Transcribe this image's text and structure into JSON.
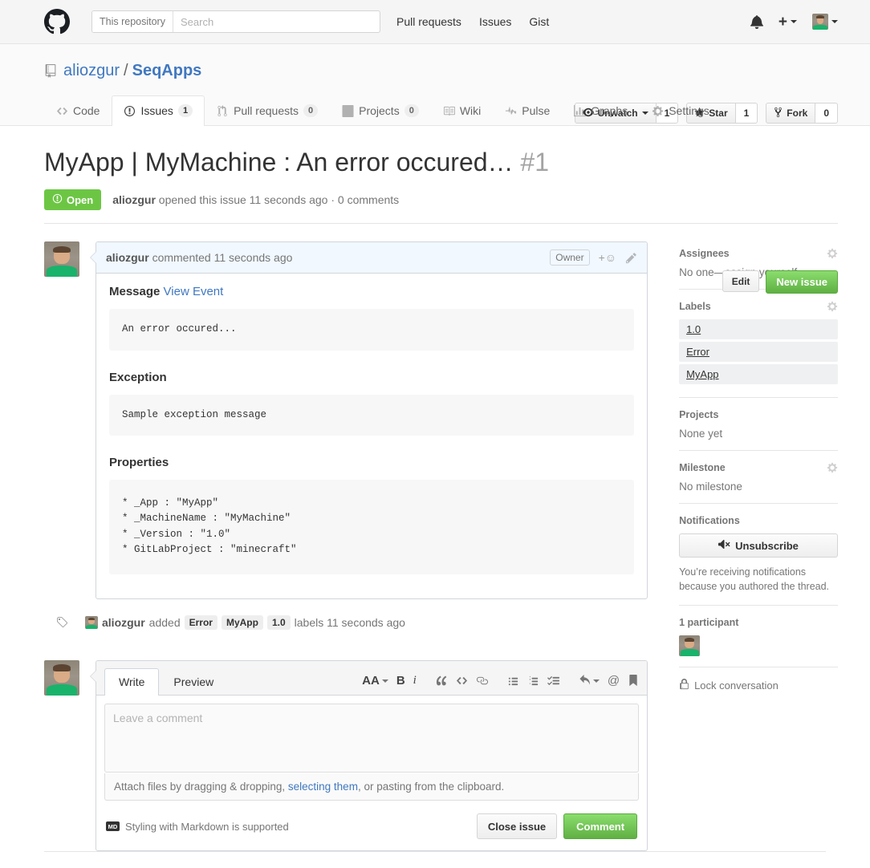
{
  "header": {
    "logo_icon": "github-mark-icon",
    "search": {
      "context": "This repository",
      "placeholder": "Search",
      "value": ""
    },
    "nav": [
      {
        "label": "Pull requests"
      },
      {
        "label": "Issues"
      },
      {
        "label": "Gist"
      }
    ],
    "notifications_icon": "bell-icon",
    "create_new_icon": "plus-icon",
    "avatar_icon": "user-avatar"
  },
  "repo": {
    "book_icon": "repo-book-icon",
    "owner": "aliozgur",
    "separator": "/",
    "name": "SeqApps",
    "actions": [
      {
        "icon": "eye-icon",
        "label": "Unwatch",
        "count": "1",
        "has_caret": true
      },
      {
        "icon": "star-icon",
        "label": "Star",
        "count": "1",
        "has_caret": false
      },
      {
        "icon": "fork-icon",
        "label": "Fork",
        "count": "0",
        "has_caret": false
      }
    ],
    "tabs": [
      {
        "icon": "code-icon",
        "label": "Code",
        "count": null,
        "selected": false
      },
      {
        "icon": "issue-opened-icon",
        "label": "Issues",
        "count": "1",
        "selected": true
      },
      {
        "icon": "git-pull-request-icon",
        "label": "Pull requests",
        "count": "0",
        "selected": false
      },
      {
        "icon": "project-icon",
        "label": "Projects",
        "count": "0",
        "selected": false
      },
      {
        "icon": "book-icon",
        "label": "Wiki",
        "count": null,
        "selected": false
      },
      {
        "icon": "pulse-icon",
        "label": "Pulse",
        "count": null,
        "selected": false
      },
      {
        "icon": "graph-icon",
        "label": "Graphs",
        "count": null,
        "selected": false
      },
      {
        "icon": "gear-icon",
        "label": "Settings",
        "count": null,
        "selected": false
      }
    ]
  },
  "issue": {
    "title": "MyApp | MyMachine : An error occured…",
    "number": "#1",
    "edit_label": "Edit",
    "new_issue_label": "New issue",
    "state_icon": "issue-opened-icon",
    "state_label": "Open",
    "meta_author": "aliozgur",
    "meta_text": "opened this issue 11 seconds ago · 0 comments"
  },
  "comment": {
    "author": "aliozgur",
    "action_text": "commented 11 seconds ago",
    "owner_badge": "Owner",
    "reaction_icon": "add-reaction-icon",
    "edit_icon": "pencil-icon",
    "sections": [
      {
        "heading": "Message",
        "link": "View Event",
        "code": "An error occured..."
      },
      {
        "heading": "Exception",
        "link": null,
        "code": "Sample exception message"
      },
      {
        "heading": "Properties",
        "link": null,
        "code": "* _App : \"MyApp\"\n* _MachineName : \"MyMachine\"\n* _Version : \"1.0\"\n* GitLabProject : \"minecraft\""
      }
    ]
  },
  "timeline": {
    "icon": "tag-icon",
    "author": "aliozgur",
    "verb": "added",
    "labels": [
      "Error",
      "MyApp",
      "1.0"
    ],
    "suffix": "labels 11 seconds ago"
  },
  "comment_form": {
    "tabs": [
      {
        "label": "Write",
        "active": true
      },
      {
        "label": "Preview",
        "active": false
      }
    ],
    "toolbar": [
      {
        "icon": "text-size-icon",
        "label": "AA"
      },
      {
        "icon": "bold-icon",
        "label": "B"
      },
      {
        "icon": "italic-icon",
        "label": "i"
      },
      {
        "icon": "quote-icon",
        "label": "“"
      },
      {
        "icon": "code-icon",
        "label": "<>"
      },
      {
        "icon": "link-icon",
        "label": "link"
      },
      {
        "icon": "unordered-list-icon",
        "label": "list"
      },
      {
        "icon": "ordered-list-icon",
        "label": "numbered list"
      },
      {
        "icon": "task-list-icon",
        "label": "task list"
      },
      {
        "icon": "reply-icon",
        "label": "reply"
      },
      {
        "icon": "mention-icon",
        "label": "@"
      },
      {
        "icon": "saved-replies-icon",
        "label": "bookmark"
      }
    ],
    "textarea_placeholder": "Leave a comment",
    "textarea_value": "",
    "attach_prefix": "Attach files by dragging & dropping, ",
    "attach_link": "selecting them",
    "attach_suffix": ", or pasting from the clipboard.",
    "markdown_badge": "MD",
    "markdown_note": "Styling with Markdown is supported",
    "close_issue_label": "Close issue",
    "comment_label": "Comment"
  },
  "sidebar": {
    "assignees": {
      "title": "Assignees",
      "gear_icon": "gear-icon",
      "empty": "No one—assign yourself"
    },
    "labels": {
      "title": "Labels",
      "gear_icon": "gear-icon",
      "items": [
        "1.0",
        "Error",
        "MyApp"
      ]
    },
    "projects": {
      "title": "Projects",
      "empty": "None yet"
    },
    "milestone": {
      "title": "Milestone",
      "gear_icon": "gear-icon",
      "empty": "No milestone"
    },
    "notifications": {
      "title": "Notifications",
      "button_icon": "mute-icon",
      "button_label": "Unsubscribe",
      "note": "You’re receiving notifications because you authored the thread."
    },
    "participants": {
      "title": "1 participant",
      "avatar_icon": "user-avatar"
    },
    "lock": {
      "icon": "lock-icon",
      "label": "Lock conversation"
    }
  },
  "colors": {
    "accent_blue": "#4078c0",
    "green": "#6cc644",
    "green_button": "#60b044",
    "muted": "#767676",
    "comment_header_bg": "#f1f8ff"
  }
}
